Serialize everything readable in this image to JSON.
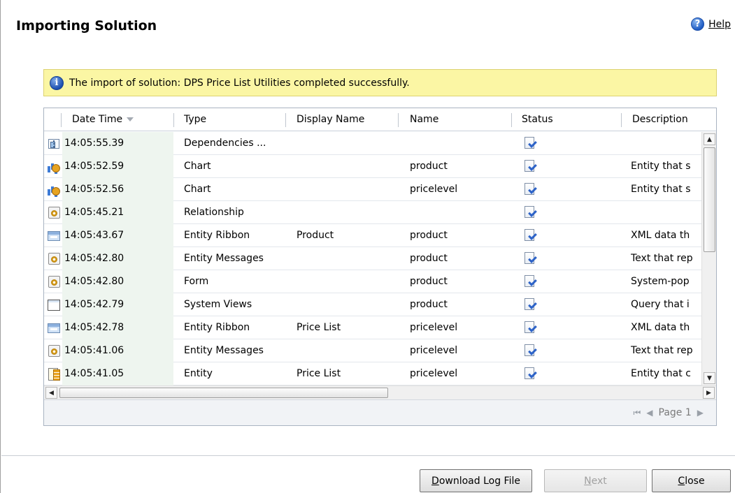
{
  "dialog": {
    "title": "Importing Solution",
    "help_label": "Help"
  },
  "notice": {
    "text": "The import of solution: DPS Price List Utilities completed successfully."
  },
  "grid": {
    "columns": [
      "Date Time",
      "Type",
      "Display Name",
      "Name",
      "Status",
      "Description"
    ],
    "sorted_column": "Date Time",
    "rows": [
      {
        "icon": "dependencies-icon",
        "date": "14:05:55.39",
        "type": "Dependencies ...",
        "display": "",
        "name": "",
        "status": "success-icon",
        "desc": ""
      },
      {
        "icon": "chart-icon",
        "date": "14:05:52.59",
        "type": "Chart",
        "display": "",
        "name": "product",
        "status": "success-icon",
        "desc": "Entity that s"
      },
      {
        "icon": "chart-icon",
        "date": "14:05:52.56",
        "type": "Chart",
        "display": "",
        "name": "pricelevel",
        "status": "success-icon",
        "desc": "Entity that s"
      },
      {
        "icon": "gear-icon",
        "date": "14:05:45.21",
        "type": "Relationship",
        "display": "",
        "name": "",
        "status": "success-icon",
        "desc": ""
      },
      {
        "icon": "ribbon-icon",
        "date": "14:05:43.67",
        "type": "Entity Ribbon",
        "display": "Product",
        "name": "product",
        "status": "success-icon",
        "desc": "XML data th"
      },
      {
        "icon": "gear-icon",
        "date": "14:05:42.80",
        "type": "Entity Messages",
        "display": "",
        "name": "product",
        "status": "success-icon",
        "desc": "Text that rep"
      },
      {
        "icon": "gear-icon",
        "date": "14:05:42.80",
        "type": "Form",
        "display": "",
        "name": "product",
        "status": "success-icon",
        "desc": "System-pop"
      },
      {
        "icon": "views-icon",
        "date": "14:05:42.79",
        "type": "System Views",
        "display": "",
        "name": "product",
        "status": "success-icon",
        "desc": "Query that i"
      },
      {
        "icon": "ribbon-icon",
        "date": "14:05:42.78",
        "type": "Entity Ribbon",
        "display": "Price List",
        "name": "pricelevel",
        "status": "success-icon",
        "desc": "XML data th"
      },
      {
        "icon": "gear-icon",
        "date": "14:05:41.06",
        "type": "Entity Messages",
        "display": "",
        "name": "pricelevel",
        "status": "success-icon",
        "desc": "Text that rep"
      },
      {
        "icon": "entity-icon",
        "date": "14:05:41.05",
        "type": "Entity",
        "display": "Price List",
        "name": "pricelevel",
        "status": "success-icon",
        "desc": "Entity that c"
      }
    ]
  },
  "pager": {
    "page_label": "Page 1"
  },
  "buttons": {
    "download_prefix": "D",
    "download_rest": "ownload Log File",
    "next_prefix": "N",
    "next_rest": "ext",
    "close_prefix": "C",
    "close_rest": "lose"
  }
}
